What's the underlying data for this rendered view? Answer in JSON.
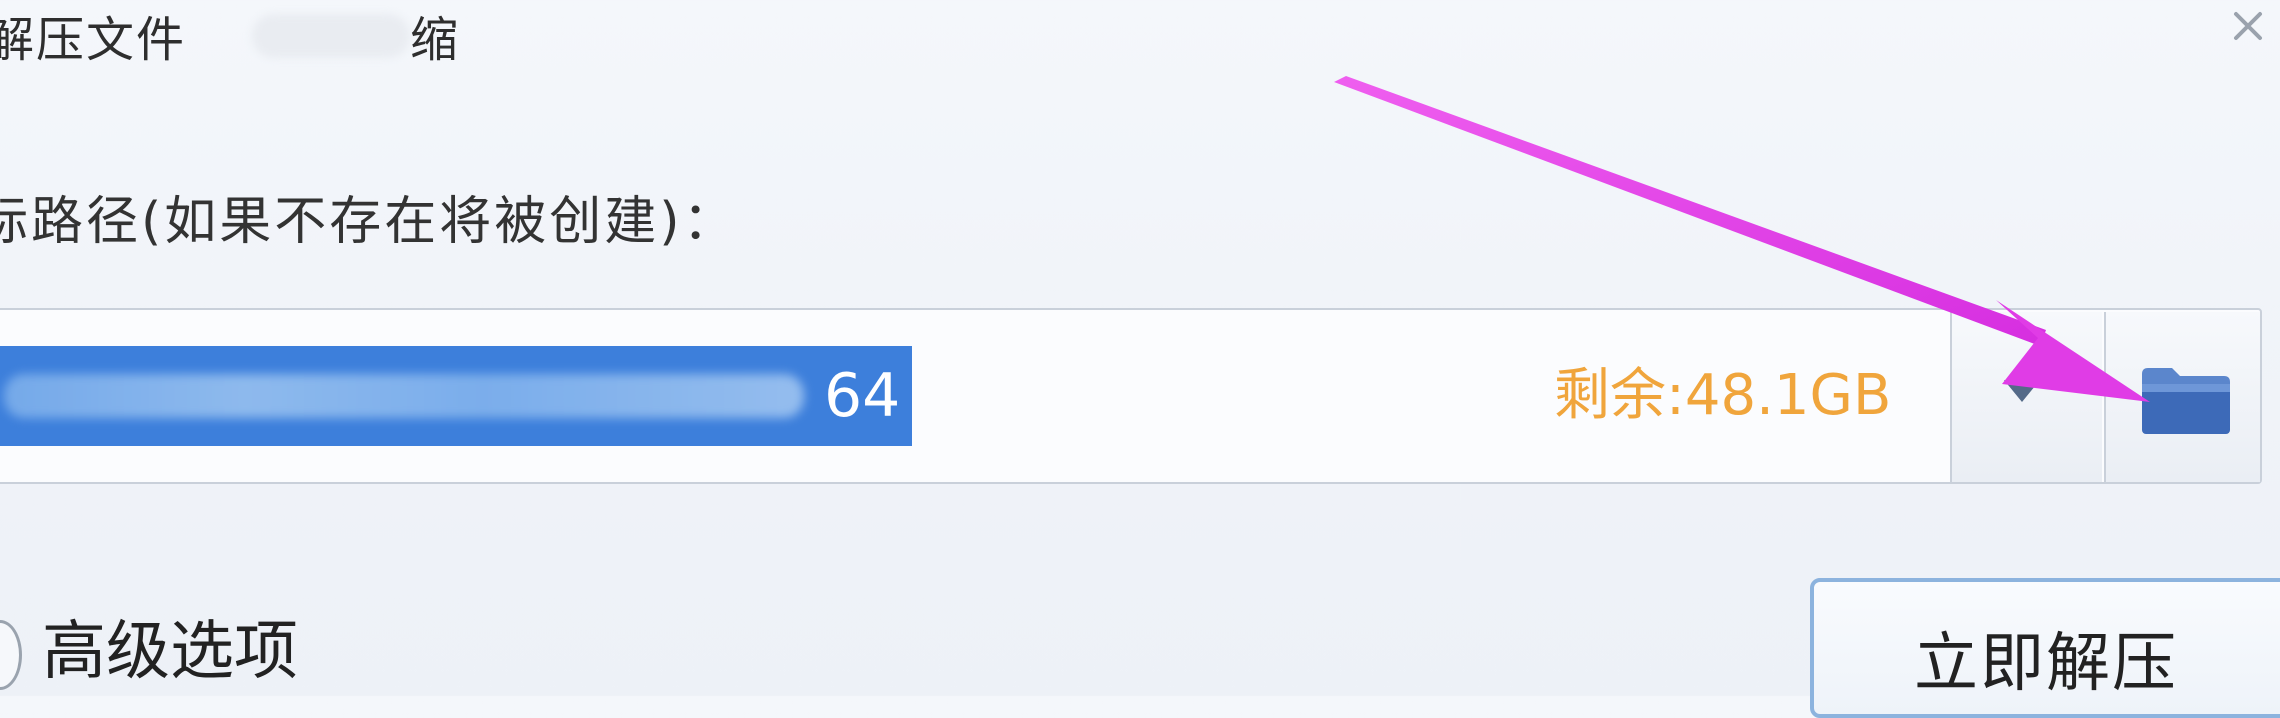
{
  "title": {
    "prefix": "解压文件",
    "suffix": "缩"
  },
  "destination": {
    "label": "标路径(如果不存在将被创建)：",
    "path_visible_tail": "64",
    "free_space": "剩余:48.1GB"
  },
  "advanced": {
    "label": "高级选项"
  },
  "extract_button": {
    "label": "立即解压"
  },
  "colors": {
    "selection": "#3d7fdb",
    "free_space_text": "#f0a53c",
    "annotation_arrow": "#e23de6",
    "folder_icon": "#3d6ab8"
  }
}
